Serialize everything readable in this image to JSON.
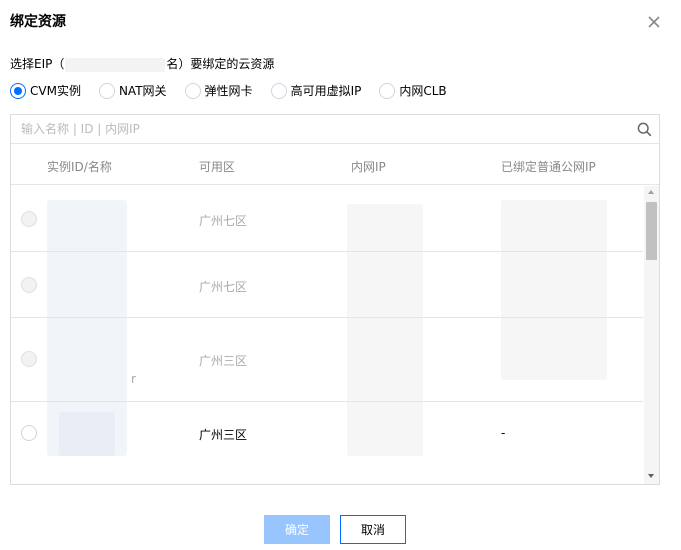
{
  "dialog": {
    "title": "绑定资源",
    "subtitle_prefix": "选择EIP（",
    "subtitle_suffix": "名）要绑定的云资源"
  },
  "resource_types": [
    {
      "label": "CVM实例",
      "checked": true
    },
    {
      "label": "NAT网关",
      "checked": false
    },
    {
      "label": "弹性网卡",
      "checked": false
    },
    {
      "label": "高可用虚拟IP",
      "checked": false
    },
    {
      "label": "内网CLB",
      "checked": false
    }
  ],
  "search": {
    "placeholder": "输入名称 | ID | 内网IP"
  },
  "table": {
    "headers": [
      "实例ID/名称",
      "可用区",
      "内网IP",
      "已绑定普通公网IP"
    ],
    "rows": [
      {
        "zone": "广州七区",
        "bound_ip": "",
        "selectable": false
      },
      {
        "zone": "广州七区",
        "bound_ip": "",
        "selectable": false
      },
      {
        "zone": "广州三区",
        "bound_ip": "",
        "name_tail": "r",
        "selectable": false
      },
      {
        "zone": "广州三区",
        "bound_ip": "-",
        "selectable": true
      }
    ]
  },
  "footer": {
    "ok_label": "确定",
    "cancel_label": "取消"
  },
  "colors": {
    "accent": "#006eff",
    "ok_disabled": "#99c5ff"
  },
  "icons": [
    "close-icon",
    "search-icon"
  ]
}
